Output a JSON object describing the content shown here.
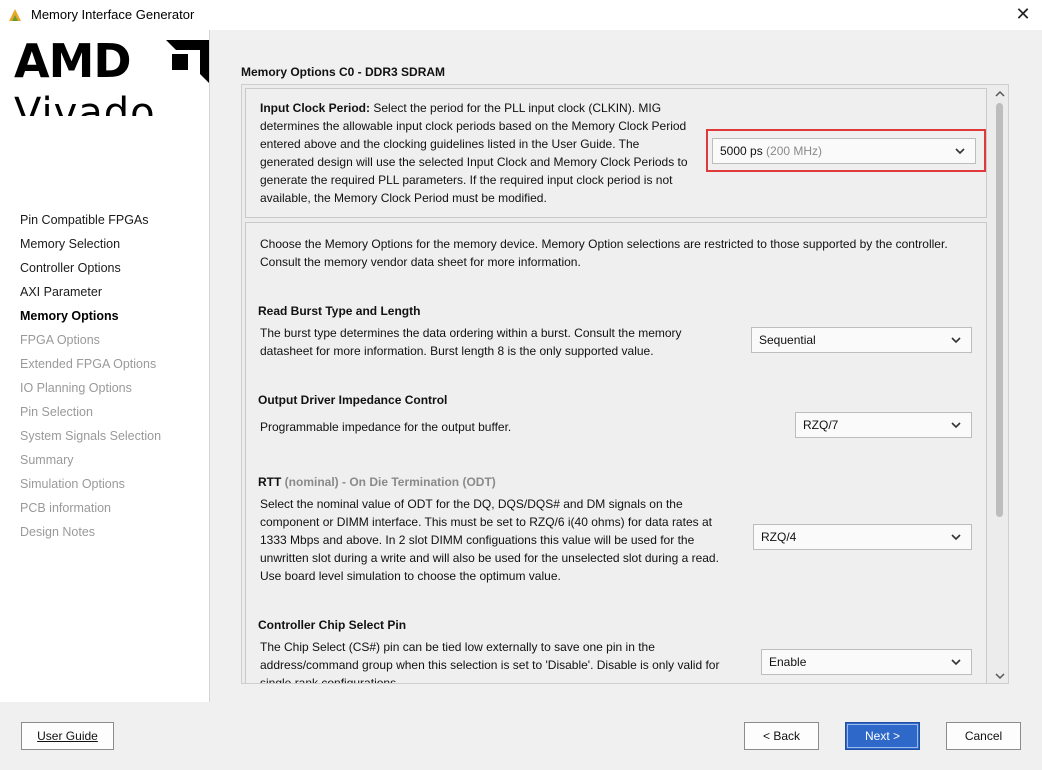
{
  "window": {
    "title": "Memory Interface Generator",
    "app_icon": "vivado-triangle-icon",
    "close_glyph": "✕"
  },
  "logo": {
    "brand": "AMD",
    "product": "Vivado"
  },
  "sidebar": {
    "items": [
      {
        "label": "Pin Compatible FPGAs",
        "state": "normal"
      },
      {
        "label": "Memory Selection",
        "state": "normal"
      },
      {
        "label": "Controller Options",
        "state": "normal"
      },
      {
        "label": "AXI Parameter",
        "state": "normal"
      },
      {
        "label": "Memory Options",
        "state": "active"
      },
      {
        "label": "FPGA Options",
        "state": "disabled"
      },
      {
        "label": "Extended FPGA Options",
        "state": "disabled"
      },
      {
        "label": "IO Planning Options",
        "state": "disabled"
      },
      {
        "label": "Pin Selection",
        "state": "disabled"
      },
      {
        "label": "System Signals Selection",
        "state": "disabled"
      },
      {
        "label": "Summary",
        "state": "disabled"
      },
      {
        "label": "Simulation Options",
        "state": "disabled"
      },
      {
        "label": "PCB information",
        "state": "disabled"
      },
      {
        "label": "Design Notes",
        "state": "disabled"
      }
    ]
  },
  "main": {
    "section_title": "Memory Options C0 - DDR3 SDRAM",
    "input_clock": {
      "label": "Input Clock Period:",
      "description_lines": [
        " Select the period for the PLL input clock (CLKIN). MIG",
        "determines the allowable input clock periods based on the Memory Clock Period",
        "entered above and the clocking guidelines listed in the User Guide. The",
        "generated design will use the selected Input Clock and Memory Clock Periods to",
        "generate the required PLL parameters. If the required input clock period is not",
        "available, the Memory Clock Period must be modified."
      ],
      "value": "5000 ps",
      "value_sub": "(200 MHz)",
      "highlight_color": "#e0393c"
    },
    "intro_lines": [
      "Choose the Memory Options for the memory device. Memory Option selections are restricted to those supported by the controller.",
      "Consult the memory vendor data sheet for more information."
    ],
    "burst": {
      "heading": "Read Burst Type and Length",
      "lines": [
        "The burst type determines the data ordering within a burst. Consult the memory",
        "datasheet for more information. Burst length 8 is the only supported value."
      ],
      "value": "Sequential"
    },
    "odic": {
      "heading": "Output Driver Impedance Control",
      "lines": [
        "Programmable impedance for the output buffer."
      ],
      "value": "RZQ/7"
    },
    "rtt": {
      "heading": "RTT",
      "heading_gray": " (nominal)",
      "heading_rest": " - On Die Termination (ODT)",
      "lines": [
        "Select the nominal value of ODT for the DQ, DQS/DQS# and DM signals on the",
        "component or DIMM interface. This must be set to RZQ/6 i(40 ohms) for data rates at",
        "1333 Mbps and above. In 2 slot DIMM configuations this value will be used for the",
        "unwritten slot during a write and will also be used for the unselected slot during a read.",
        "Use board level simulation to choose the optimum value."
      ],
      "value": "RZQ/4"
    },
    "cs": {
      "heading": "Controller Chip Select Pin",
      "lines": [
        "The Chip Select (CS#) pin can be tied low externally to save one pin in the",
        "address/command group when this selection is set to 'Disable'. Disable is only valid for",
        "single rank configurations."
      ],
      "value": "Enable"
    }
  },
  "footer": {
    "user_guide": "User Guide",
    "back": "< Back",
    "next": "Next >",
    "cancel": "Cancel",
    "accent": "#2e68c8"
  }
}
